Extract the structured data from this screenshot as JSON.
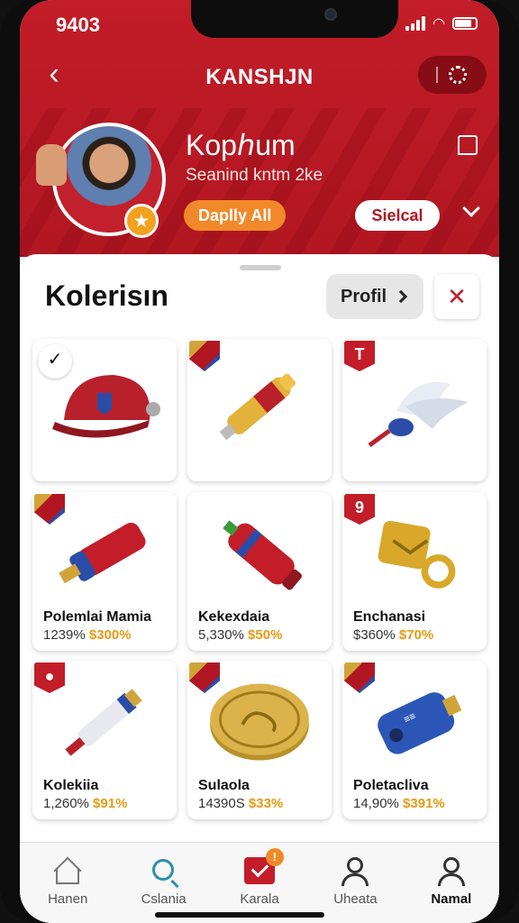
{
  "status": {
    "time": "9403"
  },
  "nav": {
    "title": "KANSHJN"
  },
  "profile": {
    "name": "Kopℎum",
    "subtitle": "Seanind kntm 2ke",
    "daily_button": "Daplly All",
    "select_button": "Sielcal"
  },
  "section": {
    "title": "Kolerisın",
    "profile_button": "Profil"
  },
  "items": [
    {
      "name": "",
      "price_a": "",
      "price_b": "",
      "tag": "check",
      "tag_text": "✓",
      "illustration": "red-cap"
    },
    {
      "name": "",
      "price_a": "",
      "price_b": "",
      "tag": "shield",
      "tag_text": "",
      "illustration": "gold-vial"
    },
    {
      "name": "",
      "price_a": "",
      "price_b": "",
      "tag": "red",
      "tag_text": "T",
      "illustration": "wing-bottle"
    },
    {
      "name": "Polemlai Mamia",
      "price_a": "1239%",
      "price_b": "$300%",
      "tag": "shield",
      "tag_text": "",
      "illustration": "red-canister"
    },
    {
      "name": "Kekexdaia",
      "price_a": "5,330%",
      "price_b": "$50%",
      "tag": "none",
      "tag_text": "",
      "illustration": "red-bottle"
    },
    {
      "name": "Enchanasi",
      "price_a": "$360%",
      "price_b": "$70%",
      "tag": "red",
      "tag_text": "9",
      "illustration": "gold-key"
    },
    {
      "name": "Kolekiia",
      "price_a": "1,260%",
      "price_b": "$91%",
      "tag": "red",
      "tag_text": "●",
      "illustration": "white-vial"
    },
    {
      "name": "Sulaola",
      "price_a": "14390S",
      "price_b": "$33%",
      "tag": "shield",
      "tag_text": "",
      "illustration": "gold-coin"
    },
    {
      "name": "Poletacliva",
      "price_a": "14,90%",
      "price_b": "$391%",
      "tag": "shield",
      "tag_text": "",
      "illustration": "blue-canister"
    }
  ],
  "tabs": [
    {
      "label": "Hanen",
      "icon": "home-icon"
    },
    {
      "label": "Cslania",
      "icon": "search-icon"
    },
    {
      "label": "Karala",
      "icon": "bag-icon",
      "badge": "!"
    },
    {
      "label": "Uheata",
      "icon": "user-icon"
    },
    {
      "label": "Namal",
      "icon": "user-icon"
    }
  ],
  "colors": {
    "brand_red": "#c21d28",
    "accent_orange": "#f1892a",
    "price_gold": "#e89a12"
  }
}
